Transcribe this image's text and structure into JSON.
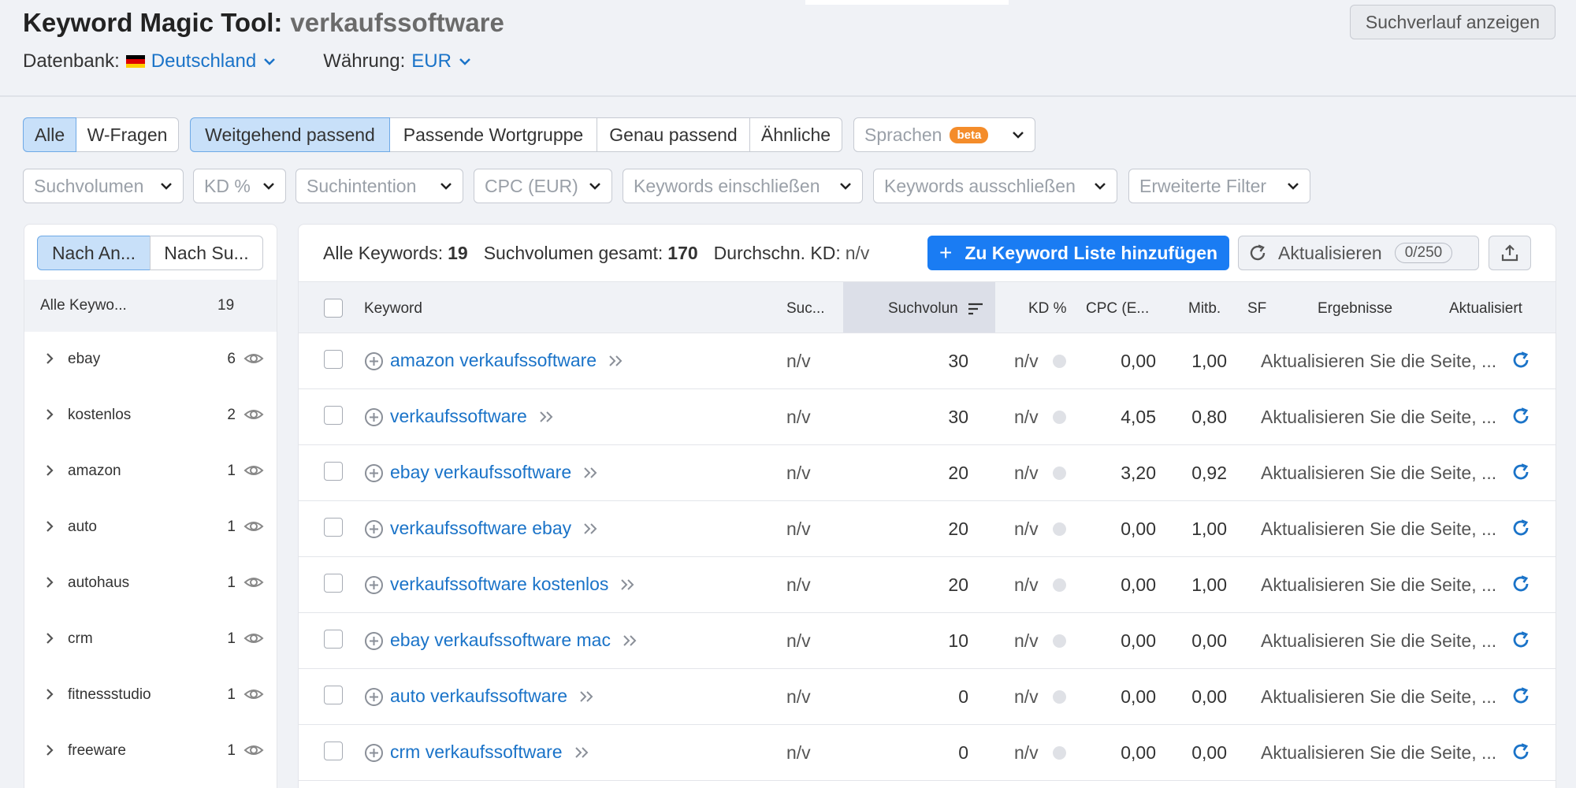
{
  "header": {
    "title_prefix": "Keyword Magic Tool:",
    "title_keyword": "verkaufssoftware",
    "history_button": "Suchverlauf anzeigen",
    "database_label": "Datenbank:",
    "database_value": "Deutschland",
    "currency_label": "Währung:",
    "currency_value": "EUR"
  },
  "filters": {
    "question_tabs": [
      "Alle",
      "W-Fragen"
    ],
    "match_tabs": [
      "Weitgehend passend",
      "Passende Wortgruppe",
      "Genau passend",
      "Ähnliche"
    ],
    "languages": "Sprachen",
    "beta_badge": "beta",
    "dropdowns": [
      "Suchvolumen",
      "KD %",
      "Suchintention",
      "CPC (EUR)",
      "Keywords einschließen",
      "Keywords ausschließen",
      "Erweiterte Filter"
    ]
  },
  "sidebar": {
    "tabs": [
      "Nach An...",
      "Nach Su..."
    ],
    "all_label": "Alle Keywo...",
    "all_count": "19",
    "groups": [
      {
        "name": "ebay",
        "count": "6"
      },
      {
        "name": "kostenlos",
        "count": "2"
      },
      {
        "name": "amazon",
        "count": "1"
      },
      {
        "name": "auto",
        "count": "1"
      },
      {
        "name": "autohaus",
        "count": "1"
      },
      {
        "name": "crm",
        "count": "1"
      },
      {
        "name": "fitnessstudio",
        "count": "1"
      },
      {
        "name": "freeware",
        "count": "1"
      }
    ]
  },
  "summary": {
    "all_keywords_label": "Alle Keywords:",
    "all_keywords_value": "19",
    "volume_label": "Suchvolumen gesamt:",
    "volume_value": "170",
    "kd_label": "Durchschn. KD:",
    "kd_value": "n/v"
  },
  "actions": {
    "add_to_list": "Zu Keyword Liste hinzufügen",
    "refresh": "Aktualisieren",
    "refresh_count": "0/250"
  },
  "table": {
    "headers": {
      "keyword": "Keyword",
      "intent": "Suc...",
      "volume": "Suchvolun",
      "kd": "KD %",
      "cpc": "CPC (E...",
      "com": "Mitb.",
      "sf": "SF",
      "results": "Ergebnisse",
      "updated": "Aktualisiert"
    },
    "rows": [
      {
        "keyword": "amazon verkaufssoftware",
        "intent": "n/v",
        "volume": "30",
        "kd": "n/v",
        "cpc": "0,00",
        "com": "1,00",
        "results": "Aktualisieren Sie die Seite, ..."
      },
      {
        "keyword": "verkaufssoftware",
        "intent": "n/v",
        "volume": "30",
        "kd": "n/v",
        "cpc": "4,05",
        "com": "0,80",
        "results": "Aktualisieren Sie die Seite, ..."
      },
      {
        "keyword": "ebay verkaufssoftware",
        "intent": "n/v",
        "volume": "20",
        "kd": "n/v",
        "cpc": "3,20",
        "com": "0,92",
        "results": "Aktualisieren Sie die Seite, ..."
      },
      {
        "keyword": "verkaufssoftware ebay",
        "intent": "n/v",
        "volume": "20",
        "kd": "n/v",
        "cpc": "0,00",
        "com": "1,00",
        "results": "Aktualisieren Sie die Seite, ..."
      },
      {
        "keyword": "verkaufssoftware kostenlos",
        "intent": "n/v",
        "volume": "20",
        "kd": "n/v",
        "cpc": "0,00",
        "com": "1,00",
        "results": "Aktualisieren Sie die Seite, ..."
      },
      {
        "keyword": "ebay verkaufssoftware mac",
        "intent": "n/v",
        "volume": "10",
        "kd": "n/v",
        "cpc": "0,00",
        "com": "0,00",
        "results": "Aktualisieren Sie die Seite, ..."
      },
      {
        "keyword": "auto verkaufssoftware",
        "intent": "n/v",
        "volume": "0",
        "kd": "n/v",
        "cpc": "0,00",
        "com": "0,00",
        "results": "Aktualisieren Sie die Seite, ..."
      },
      {
        "keyword": "crm verkaufssoftware",
        "intent": "n/v",
        "volume": "0",
        "kd": "n/v",
        "cpc": "0,00",
        "com": "0,00",
        "results": "Aktualisieren Sie die Seite, ..."
      }
    ]
  },
  "colors": {
    "accent": "#1a7cf3",
    "link": "#1a73c8",
    "active_tab": "#c8e0f9",
    "beta": "#f48c2a"
  },
  "icons": [
    "chevron-down-icon",
    "flag-de-icon",
    "plus-icon",
    "refresh-icon",
    "export-icon",
    "sort-icon",
    "chevron-right-icon",
    "eye-icon",
    "add-circle-icon",
    "double-chevron-icon"
  ]
}
